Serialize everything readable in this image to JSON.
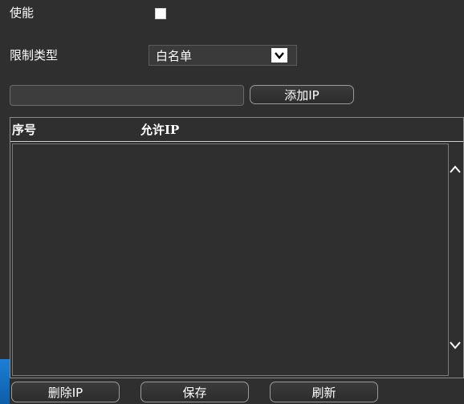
{
  "enable": {
    "label": "使能",
    "checked": false
  },
  "limit_type": {
    "label": "限制类型",
    "selected": "白名单"
  },
  "ip_input": {
    "value": "",
    "placeholder": ""
  },
  "add_ip_button": "添加IP",
  "table": {
    "columns": [
      "序号",
      "允许IP"
    ],
    "rows": []
  },
  "buttons": {
    "delete_ip": "删除IP",
    "save": "保存",
    "refresh": "刷新"
  },
  "colors": {
    "background": "#2f2f2f",
    "button_border": "#9a9a9a",
    "text": "#ffffff"
  }
}
